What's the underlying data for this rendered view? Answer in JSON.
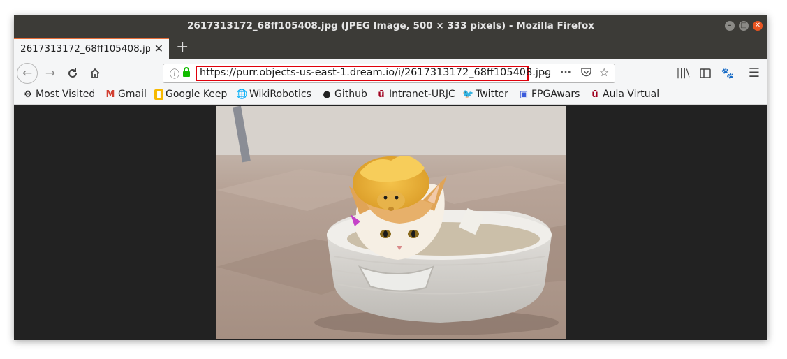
{
  "window": {
    "title": "2617313172_68ff105408.jpg (JPEG Image, 500 × 333 pixels) - Mozilla Firefox"
  },
  "tab": {
    "title": "2617313172_68ff105408.jpg",
    "close": "✕",
    "new_tab": "+"
  },
  "nav": {
    "url": "https://purr.objects-us-east-1.dream.io/i/2617313172_68ff105408.jpg"
  },
  "bookmarks": [
    {
      "label": "Most Visited",
      "icon": "gear-icon"
    },
    {
      "label": "Gmail",
      "icon": "gmail-icon"
    },
    {
      "label": "Google Keep",
      "icon": "keep-icon"
    },
    {
      "label": "WikiRobotics",
      "icon": "globe-icon"
    },
    {
      "label": "Github",
      "icon": "github-icon"
    },
    {
      "label": "Intranet-URJC",
      "icon": "urjc-icon"
    },
    {
      "label": "Twitter",
      "icon": "twitter-icon"
    },
    {
      "label": "FPGAwars",
      "icon": "fpgawars-icon"
    },
    {
      "label": "Aula Virtual",
      "icon": "urjc-icon"
    }
  ],
  "colors": {
    "titlebar": "#3c3b37",
    "tab_accent": "#e66e3a",
    "toolbar": "#f5f6f7",
    "url_highlight": "#e0000b",
    "content_bg": "#222222"
  }
}
